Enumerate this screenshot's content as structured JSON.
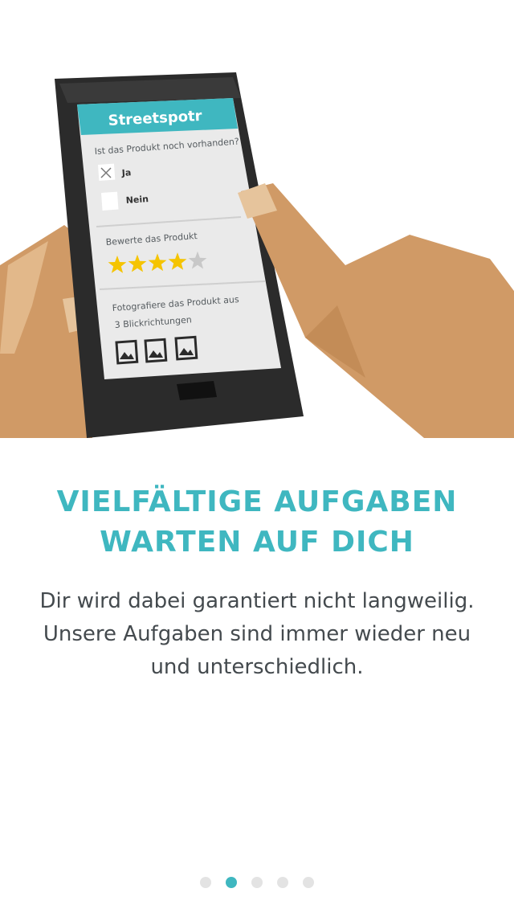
{
  "illustration": {
    "app_logo_text": "Streetspotr",
    "question_1": "Ist das Produkt noch vorhanden?",
    "option_yes": "Ja",
    "option_no": "Nein",
    "question_2": "Bewerte das Produkt",
    "rating": 4,
    "rating_max": 5,
    "question_3_line1": "Fotografiere das Produkt aus",
    "question_3_line2": "3 Blickrichtungen",
    "photo_icons": [
      "image-icon",
      "image-icon",
      "image-icon"
    ]
  },
  "headline": {
    "line1": "VIELFÄLTIGE AUFGABEN",
    "line2": "WARTEN AUF DICH"
  },
  "body": {
    "line1": "Dir wird dabei garantiert nicht langweilig.",
    "line2": "Unsere Aufgaben sind immer wieder neu",
    "line3": "und unterschiedlich."
  },
  "pager": {
    "total": 5,
    "active_index": 1
  },
  "colors": {
    "accent": "#3fb7c0",
    "skin": "#d09a66",
    "phone": "#2b2b2b",
    "star": "#f5c400"
  }
}
